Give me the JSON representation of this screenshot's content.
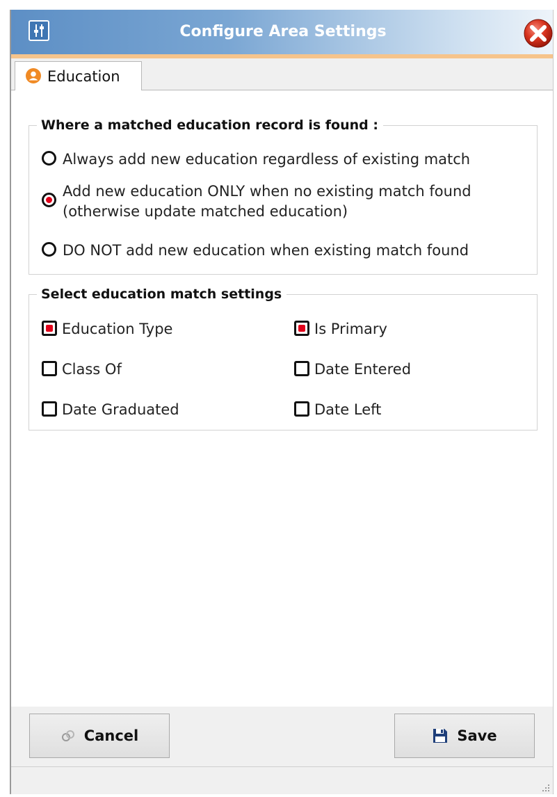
{
  "window": {
    "title": "Configure Area Settings",
    "icons": {
      "app": "settings-sliders-icon",
      "close": "close-icon"
    },
    "colors": {
      "title_gradient_start": "#5d8fc5",
      "accent_line": "#f6c48c",
      "selection": "#e1001a"
    }
  },
  "tabs": [
    {
      "label": "Education",
      "icon": "user-icon",
      "active": true
    }
  ],
  "match_behavior": {
    "legend": "Where a matched education record is found :",
    "options": [
      {
        "label": "Always add new education regardless of existing match",
        "selected": false
      },
      {
        "label_line1": "Add new education ONLY when no existing match found",
        "label_line2": "(otherwise update matched education)",
        "selected": true
      },
      {
        "label": "DO NOT add new education when existing match found",
        "selected": false
      }
    ]
  },
  "match_settings": {
    "legend": "Select education match settings",
    "fields": [
      {
        "label": "Education Type",
        "checked": true
      },
      {
        "label": "Is Primary",
        "checked": true
      },
      {
        "label": "Class Of",
        "checked": false
      },
      {
        "label": "Date Entered",
        "checked": false
      },
      {
        "label": "Date Graduated",
        "checked": false
      },
      {
        "label": "Date Left",
        "checked": false
      }
    ]
  },
  "actions": {
    "cancel_label": "Cancel",
    "save_label": "Save",
    "cancel_icon": "link-icon",
    "save_icon": "floppy-disk-icon"
  }
}
